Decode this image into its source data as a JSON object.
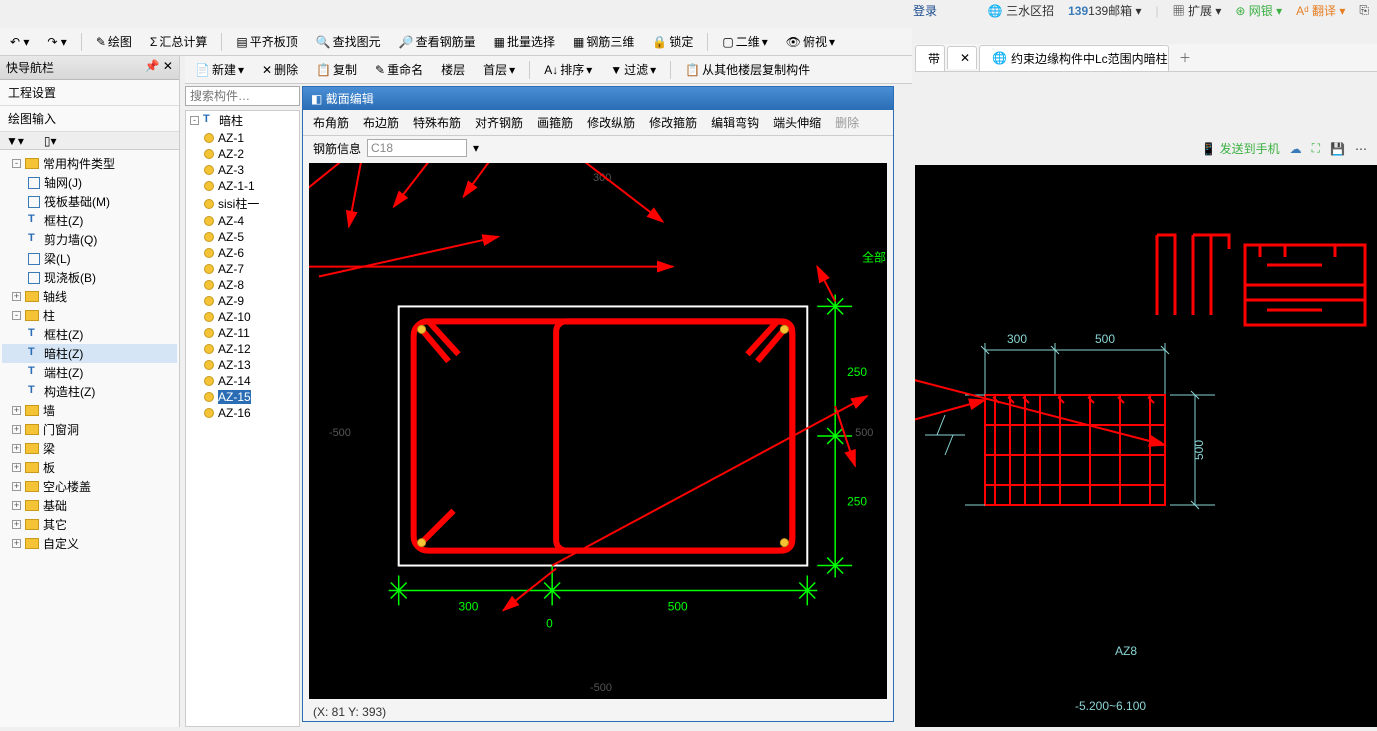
{
  "login_label": "登录",
  "browser_links": [
    "三水区招",
    "139邮箱",
    "扩展",
    "网银",
    "翻译"
  ],
  "browser_tab": {
    "title": "约束边缘构件中Lc范围内暗柱以"
  },
  "action_row": {
    "send": "发送到手机"
  },
  "toolbar1": {
    "draw": "绘图",
    "sum": "汇总计算",
    "flat": "平齐板顶",
    "find": "查找图元",
    "view_rebar": "查看钢筋量",
    "batch": "批量选择",
    "rebar3d": "钢筋三维",
    "lock": "锁定",
    "mode2d": "二维",
    "view": "俯视"
  },
  "toolbar2": {
    "new": "新建",
    "delete": "删除",
    "copy": "复制",
    "rename": "重命名",
    "floors": "楼层",
    "first": "首层",
    "sort": "排序",
    "filter": "过滤",
    "copy_from": "从其他楼层复制构件"
  },
  "nav": {
    "title": "快导航栏",
    "sections": [
      "工程设置",
      "绘图输入"
    ],
    "tree": [
      {
        "d": 1,
        "t": "folder",
        "label": "常用构件类型",
        "exp": "-"
      },
      {
        "d": 2,
        "t": "sq",
        "label": "轴网(J)"
      },
      {
        "d": 2,
        "t": "sq",
        "label": "筏板基础(M)"
      },
      {
        "d": 2,
        "t": "t",
        "label": "框柱(Z)"
      },
      {
        "d": 2,
        "t": "t",
        "label": "剪力墙(Q)"
      },
      {
        "d": 2,
        "t": "sq",
        "label": "梁(L)"
      },
      {
        "d": 2,
        "t": "sq",
        "label": "现浇板(B)"
      },
      {
        "d": 1,
        "t": "folder",
        "label": "轴线",
        "exp": "+"
      },
      {
        "d": 1,
        "t": "folder",
        "label": "柱",
        "exp": "-"
      },
      {
        "d": 2,
        "t": "t",
        "label": "框柱(Z)"
      },
      {
        "d": 2,
        "t": "t",
        "label": "暗柱(Z)",
        "sel": true
      },
      {
        "d": 2,
        "t": "t",
        "label": "端柱(Z)"
      },
      {
        "d": 2,
        "t": "t",
        "label": "构造柱(Z)"
      },
      {
        "d": 1,
        "t": "folder",
        "label": "墙",
        "exp": "+"
      },
      {
        "d": 1,
        "t": "folder",
        "label": "门窗洞",
        "exp": "+"
      },
      {
        "d": 1,
        "t": "folder",
        "label": "梁",
        "exp": "+"
      },
      {
        "d": 1,
        "t": "folder",
        "label": "板",
        "exp": "+"
      },
      {
        "d": 1,
        "t": "folder",
        "label": "空心楼盖",
        "exp": "+"
      },
      {
        "d": 1,
        "t": "folder",
        "label": "基础",
        "exp": "+"
      },
      {
        "d": 1,
        "t": "folder",
        "label": "其它",
        "exp": "+"
      },
      {
        "d": 1,
        "t": "folder",
        "label": "自定义",
        "exp": "+"
      }
    ]
  },
  "search_placeholder": "搜索构件…",
  "components": {
    "root": "暗柱",
    "items": [
      "AZ-1",
      "AZ-2",
      "AZ-3",
      "AZ-1-1",
      "sisi柱一",
      "AZ-4",
      "AZ-5",
      "AZ-6",
      "AZ-7",
      "AZ-8",
      "AZ-9",
      "AZ-10",
      "AZ-11",
      "AZ-12",
      "AZ-13",
      "AZ-14",
      "AZ-15",
      "AZ-16"
    ],
    "selected": "AZ-15"
  },
  "dialog": {
    "title": "截面编辑",
    "tools": [
      "布角筋",
      "布边筋",
      "特殊布筋",
      "对齐钢筋",
      "画箍筋",
      "修改纵筋",
      "修改箍筋",
      "编辑弯钩",
      "端头伸缩",
      "删除"
    ],
    "rebar_info_label": "钢筋信息",
    "rebar_info_value": "C18",
    "status": "(X: 81 Y: 393)",
    "dims": {
      "top": "300",
      "right1": "250",
      "right2": "250",
      "bot1": "300",
      "bot0": "0",
      "bot2": "500",
      "rlabel": "全部"
    },
    "axis": {
      "h1": "500",
      "h2": "500",
      "v": "500"
    }
  },
  "right": {
    "dims": {
      "d1": "300",
      "d2": "500",
      "v": "500"
    },
    "label": "AZ8",
    "elev": "-5.200~6.100"
  }
}
